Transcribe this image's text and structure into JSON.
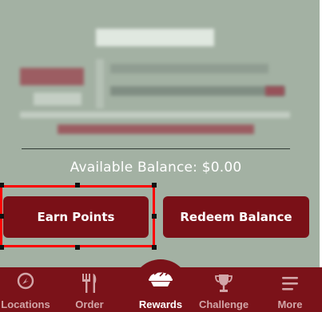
{
  "balance": {
    "label": "Available Balance: $0.00"
  },
  "buttons": {
    "earn": "Earn Points",
    "redeem": "Redeem Balance"
  },
  "tabs": [
    {
      "label": "Locations",
      "icon": "location-pin-icon"
    },
    {
      "label": "Order",
      "icon": "fork-knife-icon"
    },
    {
      "label": "Rewards",
      "icon": "pie-icon"
    },
    {
      "label": "Challenge",
      "icon": "trophy-icon"
    },
    {
      "label": "More",
      "icon": "menu-icon"
    }
  ],
  "colors": {
    "card_bg": "#a3b1a3",
    "brand": "#7a1017",
    "tab_inactive": "#d2a6a8",
    "selection": "#ff0000"
  }
}
